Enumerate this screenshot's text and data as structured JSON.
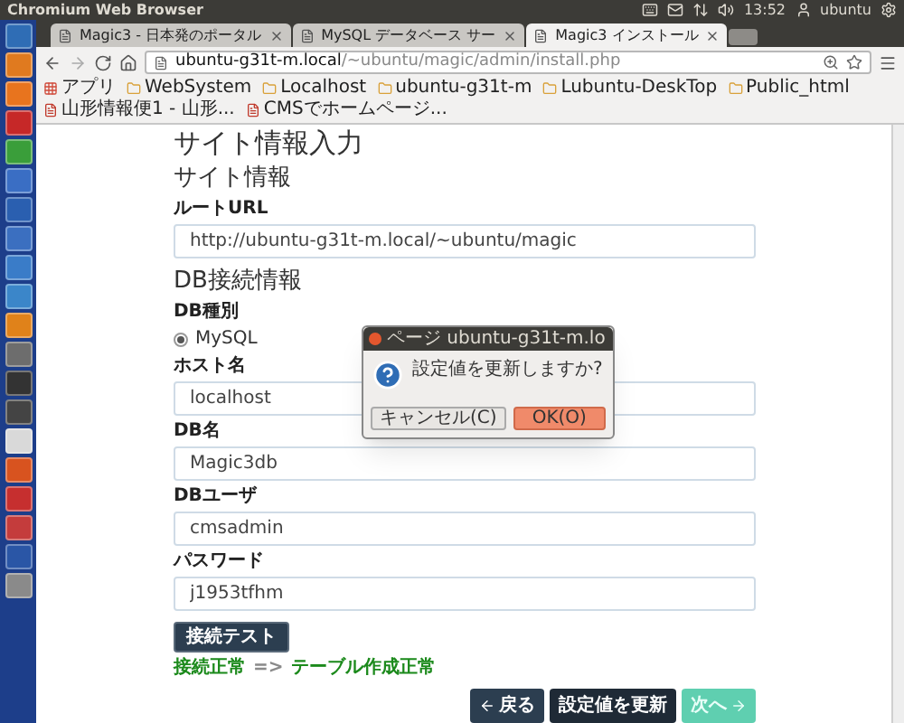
{
  "top_panel": {
    "app_title": "Chromium Web Browser",
    "time": "13:52",
    "user": "ubuntu"
  },
  "tabs": [
    {
      "title": "Magic3 - 日本発のポータル",
      "selected": false
    },
    {
      "title": "MySQL データベース サー",
      "selected": false
    },
    {
      "title": "Magic3 インストール",
      "selected": true
    }
  ],
  "address_bar": {
    "host": "ubuntu-g31t-m.local",
    "path": "/~ubuntu/magic/admin/install.php"
  },
  "bookmarks": [
    {
      "label": "アプリ",
      "kind": "apps"
    },
    {
      "label": "WebSystem",
      "kind": "folder"
    },
    {
      "label": "Localhost",
      "kind": "folder"
    },
    {
      "label": "ubuntu-g31t-m",
      "kind": "folder"
    },
    {
      "label": "Lubuntu-DeskTop",
      "kind": "folder"
    },
    {
      "label": "Public_html",
      "kind": "folder"
    },
    {
      "label": "山形情報便1 - 山形...",
      "kind": "page"
    },
    {
      "label": "CMSでホームページ...",
      "kind": "page"
    }
  ],
  "page": {
    "title": "サイト情報入力",
    "site_heading": "サイト情報",
    "root_url": {
      "label": "ルートURL",
      "value": "http://ubuntu-g31t-m.local/~ubuntu/magic"
    },
    "db_heading": "DB接続情報",
    "db_type": {
      "label": "DB種別",
      "options": [
        {
          "label": "MySQL",
          "selected": true
        }
      ]
    },
    "fields": [
      {
        "label": "ホスト名",
        "value": "localhost"
      },
      {
        "label": "DB名",
        "value": "Magic3db"
      },
      {
        "label": "DBユーザ",
        "value": "cmsadmin"
      },
      {
        "label": "パスワード",
        "value": "j1953tfhm"
      }
    ],
    "test_button": "接続テスト",
    "test_result": [
      {
        "text": "接続正常",
        "color": "#1c8a1c"
      },
      {
        "text": "=>",
        "color": "#8a8a8a"
      },
      {
        "text": "テーブル作成正常",
        "color": "#1c8a1c"
      }
    ],
    "buttons": [
      {
        "label": "戻る",
        "kind": "back",
        "disabled": false
      },
      {
        "label": "設定値を更新",
        "kind": "update",
        "disabled": false
      },
      {
        "label": "次へ",
        "kind": "next",
        "disabled": true
      }
    ]
  },
  "dialog": {
    "title": "ページ ubuntu-g31t-m.lo",
    "message": "設定値を更新しますか?",
    "buttons": [
      {
        "label": "キャンセル(C)",
        "kind": "cancel"
      },
      {
        "label": "OK(O)",
        "kind": "ok"
      }
    ]
  }
}
